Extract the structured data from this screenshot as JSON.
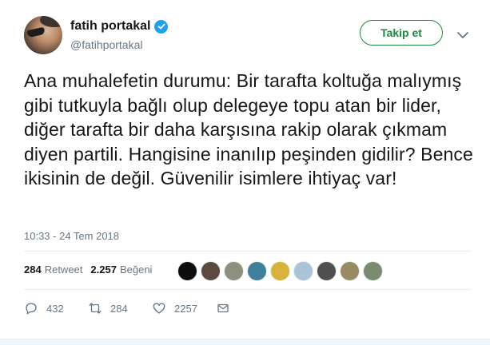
{
  "user": {
    "display_name": "fatih portakal",
    "handle": "@fatihportakal",
    "verified": true
  },
  "follow_button": {
    "label": "Takip et"
  },
  "tweet": {
    "text": "Ana muhalefetin durumu: Bir tarafta koltuğa malıymış gibi tutkuyla bağlı olup delegeye topu atan bir lider, diğer tarafta bir daha karşısına rakip olarak çıkmam diyen partili. Hangisine inanılıp peşinden gidilir? Bence ikisinin de değil. Güvenilir isimlere ihtiyaç var!",
    "timestamp": "10:33 - 24 Tem 2018"
  },
  "stats": {
    "retweets_count": "284",
    "retweets_label": "Retweet",
    "likes_count": "2.257",
    "likes_label": "Beğeni"
  },
  "likers": [
    {
      "color": "#0d0d0d"
    },
    {
      "color": "#5a4a3f"
    },
    {
      "color": "#8f8f7f"
    },
    {
      "color": "#3f7f9a"
    },
    {
      "color": "#d8b23a"
    },
    {
      "color": "#a9c4d6"
    },
    {
      "color": "#505050"
    },
    {
      "color": "#9a8a63"
    },
    {
      "color": "#7a8b70"
    }
  ],
  "actions": {
    "replies": "432",
    "retweets": "284",
    "likes": "2257"
  },
  "colors": {
    "accent_blue": "#1da1f2",
    "follow_green": "#1a8a3a",
    "muted_text": "#657786"
  },
  "icons": {
    "verified": "verified-badge-icon",
    "caret": "chevron-down-icon",
    "reply": "reply-icon",
    "retweet": "retweet-icon",
    "like": "heart-icon",
    "dm": "envelope-icon"
  }
}
